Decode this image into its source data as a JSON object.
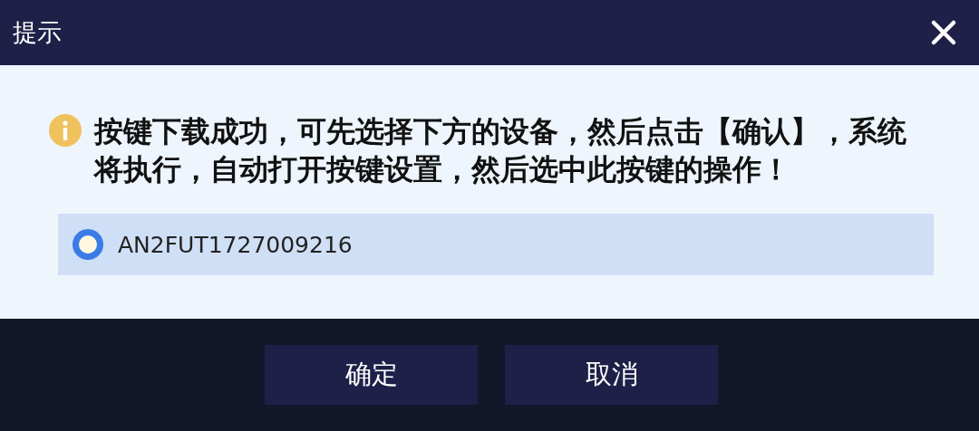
{
  "window": {
    "title": "提示"
  },
  "message": "按键下载成功，可先选择下方的设备，然后点击【确认】，系统将执行，自动打开按键设置，然后选中此按键的操作！",
  "devices": [
    {
      "name": "AN2FUT1727009216",
      "selected": true
    }
  ],
  "buttons": [
    {
      "label": "确定"
    },
    {
      "label": "取消"
    }
  ]
}
